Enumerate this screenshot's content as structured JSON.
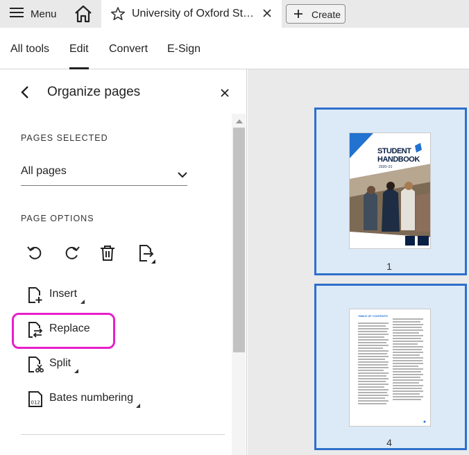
{
  "tabbar": {
    "menu_label": "Menu",
    "tab_title": "University of Oxford Stu...",
    "create_label": "Create"
  },
  "subnav": {
    "items": [
      "All tools",
      "Edit",
      "Convert",
      "E-Sign"
    ],
    "active": "Edit"
  },
  "panel": {
    "title": "Organize pages",
    "pages_selected_label": "PAGES SELECTED",
    "pages_selected_value": "All pages",
    "page_options_label": "PAGE OPTIONS",
    "options": [
      "Insert",
      "Replace",
      "Split",
      "Bates numbering"
    ],
    "highlighted_option": "Replace"
  },
  "thumbnails": {
    "pages": [
      {
        "number": "1",
        "cover_line1": "STUDENT",
        "cover_line2": "HANDBOOK",
        "cover_year": "2020–21"
      },
      {
        "number": "4",
        "toc_heading": "TABLE OF CONTENTS"
      }
    ]
  },
  "colors": {
    "accent_blue": "#2d6fcc",
    "highlight_magenta": "#e81ecb",
    "selected_bg": "#dceaf7"
  }
}
